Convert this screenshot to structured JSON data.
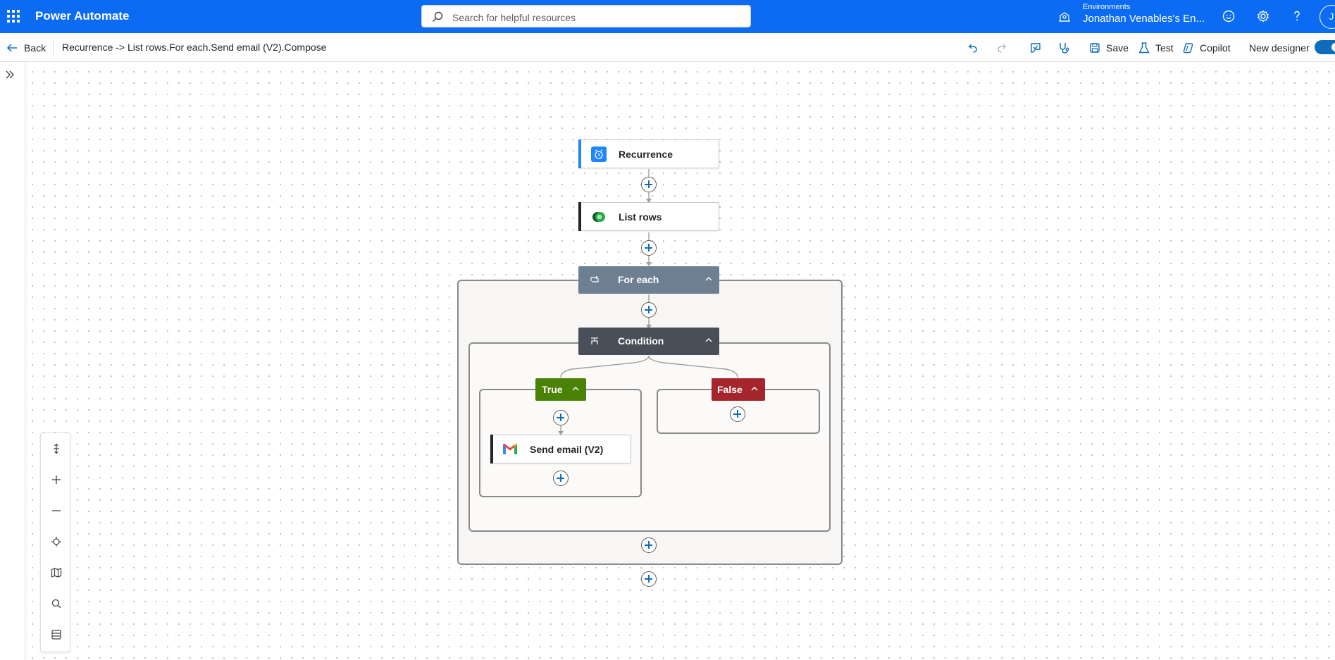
{
  "app": {
    "brand": "Power Automate"
  },
  "search": {
    "placeholder": "Search for helpful resources"
  },
  "environment": {
    "label": "Environments",
    "name": "Jonathan Venables's En..."
  },
  "user": {
    "initial": "J"
  },
  "commandbar": {
    "back_label": "Back",
    "breadcrumb": "Recurrence -> List rows.For each.Send email (V2).Compose",
    "save_label": "Save",
    "test_label": "Test",
    "copilot_label": "Copilot",
    "new_designer_label": "New designer",
    "new_designer_on": true
  },
  "flow": {
    "trigger": {
      "label": "Recurrence",
      "icon": "alarm-clock-icon",
      "color": "#1f85ff"
    },
    "list_rows": {
      "label": "List rows",
      "icon": "dataverse-icon",
      "color": "#107c10"
    },
    "for_each": {
      "label": "For each",
      "icon": "loop-icon",
      "color": "#6b7b8c"
    },
    "condition": {
      "label": "Condition",
      "icon": "condition-icon",
      "color": "#484f58"
    },
    "true_branch": {
      "label": "True",
      "color": "#498205"
    },
    "false_branch": {
      "label": "False",
      "color": "#a4262c"
    },
    "send_email": {
      "label": "Send email (V2)",
      "icon": "gmail-icon"
    }
  },
  "canvas_controls": [
    "fit-vertical-icon",
    "zoom-in-icon",
    "zoom-out-icon",
    "fit-view-icon",
    "minimap-icon",
    "search-icon",
    "list-icon"
  ]
}
